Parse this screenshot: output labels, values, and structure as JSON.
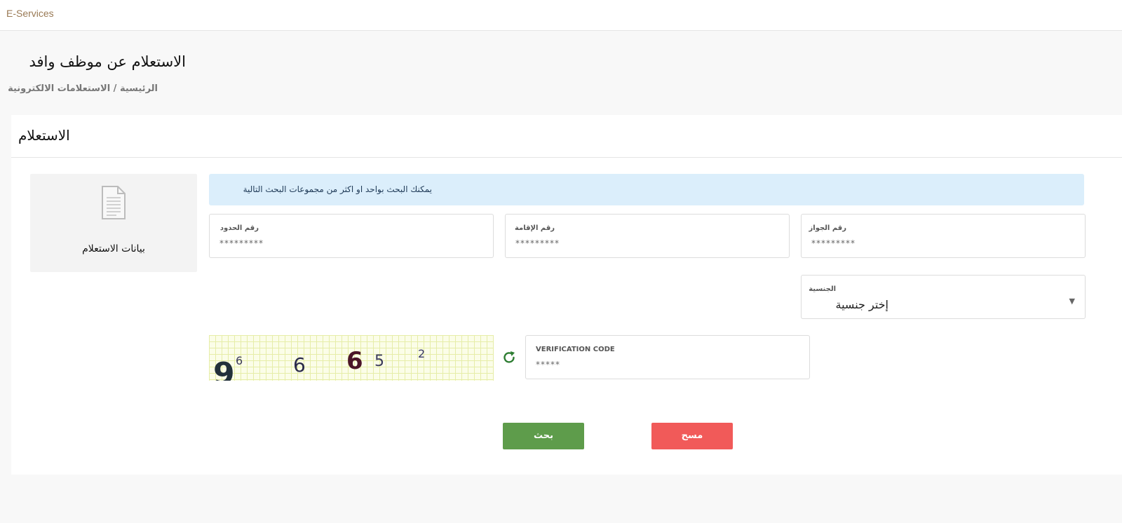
{
  "app": {
    "brand": "E-Services"
  },
  "header": {
    "title": "الاستعلام عن موظف وافد",
    "breadcrumb": "الرئيسية / الاستعلامات الالكترونية"
  },
  "card": {
    "title": "الاستعلام",
    "side_tile": {
      "icon": "document-icon",
      "label": "بيانات الاستعلام"
    },
    "info": "يمكنك البحث بواحد او اكثر من مجموعات البحث التالية",
    "fields": {
      "border_number": {
        "label": "رقم الحدود",
        "placeholder": "*********"
      },
      "iqama_number": {
        "label": "رقم الإقامة",
        "placeholder": "*********"
      },
      "passport_number": {
        "label": "رقم الجواز",
        "placeholder": "*********"
      },
      "nationality": {
        "label": "الجنسية",
        "value": "إختر جنسية"
      },
      "verification": {
        "label": "VERIFICATION CODE",
        "placeholder": "*****"
      }
    },
    "captcha": {
      "text": "9 6 6 6 5 2",
      "icon": "refresh-icon"
    },
    "buttons": {
      "search": "بحث",
      "clear": "مسح"
    }
  },
  "colors": {
    "search_button": "#5e9c4b",
    "clear_button": "#f15a59",
    "info_background": "#dbeefb",
    "brand_text": "#9a7a55"
  }
}
